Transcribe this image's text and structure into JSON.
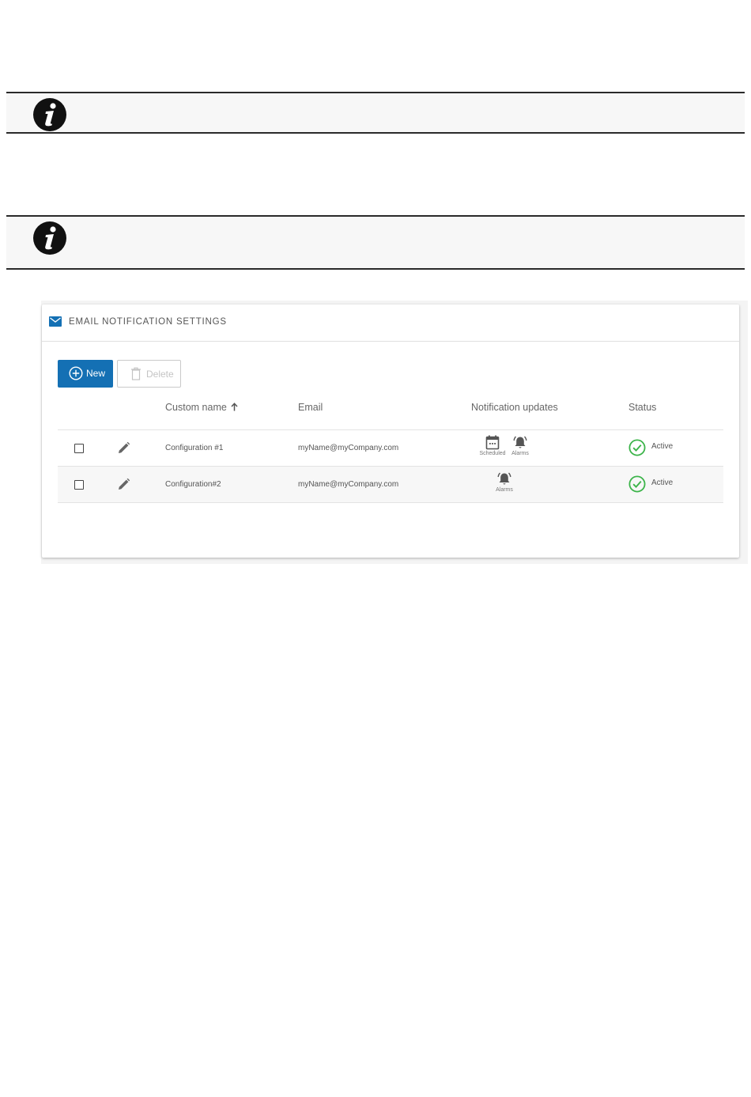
{
  "card": {
    "title": "EMAIL NOTIFICATION SETTINGS"
  },
  "toolbar": {
    "new_label": "New",
    "delete_label": "Delete"
  },
  "table": {
    "columns": [
      "Custom name",
      "Email",
      "Notification updates",
      "Status"
    ],
    "rows": [
      {
        "name": "Configuration #1",
        "email": "myName@myCompany.com",
        "notifications": [
          "Scheduled",
          "Alarms"
        ],
        "status": "Active"
      },
      {
        "name": "Configuration#2",
        "email": "myName@myCompany.com",
        "notifications": [
          "Alarms"
        ],
        "status": "Active"
      }
    ]
  },
  "colors": {
    "primary": "#1470b4",
    "active": "#3cb44a",
    "icon": "#555555"
  }
}
